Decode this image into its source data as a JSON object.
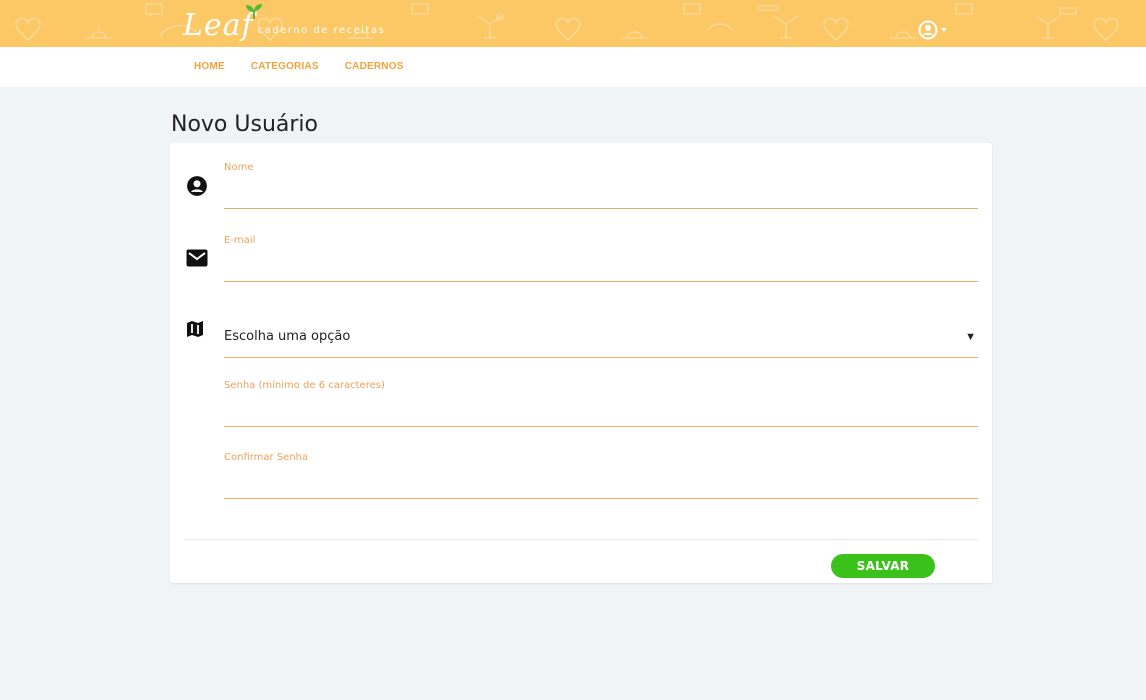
{
  "brand": {
    "logo": "Leaf",
    "subtitle": "caderno de receitas"
  },
  "nav": {
    "items": [
      "HOME",
      "CATEGORIAS",
      "CADERNOS"
    ]
  },
  "page": {
    "title": "Novo Usuário"
  },
  "form": {
    "nome": {
      "label": "Nome",
      "value": ""
    },
    "email": {
      "label": "E-mail",
      "value": ""
    },
    "select": {
      "value": "Escolha uma opção"
    },
    "senha": {
      "label": "Senha (mínimo de 6 caracteres)",
      "value": ""
    },
    "confirmar": {
      "label": "Confirmar Senha",
      "value": ""
    },
    "save_label": "SALVAR"
  },
  "icons": {
    "user_menu": "user-circle-icon",
    "nome": "user-circle-icon",
    "email": "envelope-icon",
    "select": "map-icon"
  },
  "colors": {
    "banner": "#fcc866",
    "accent": "#f0a33c",
    "label": "#e9a35a",
    "underline": "#e2b06c",
    "save": "#3ac21b",
    "background": "#f1f4f5"
  }
}
